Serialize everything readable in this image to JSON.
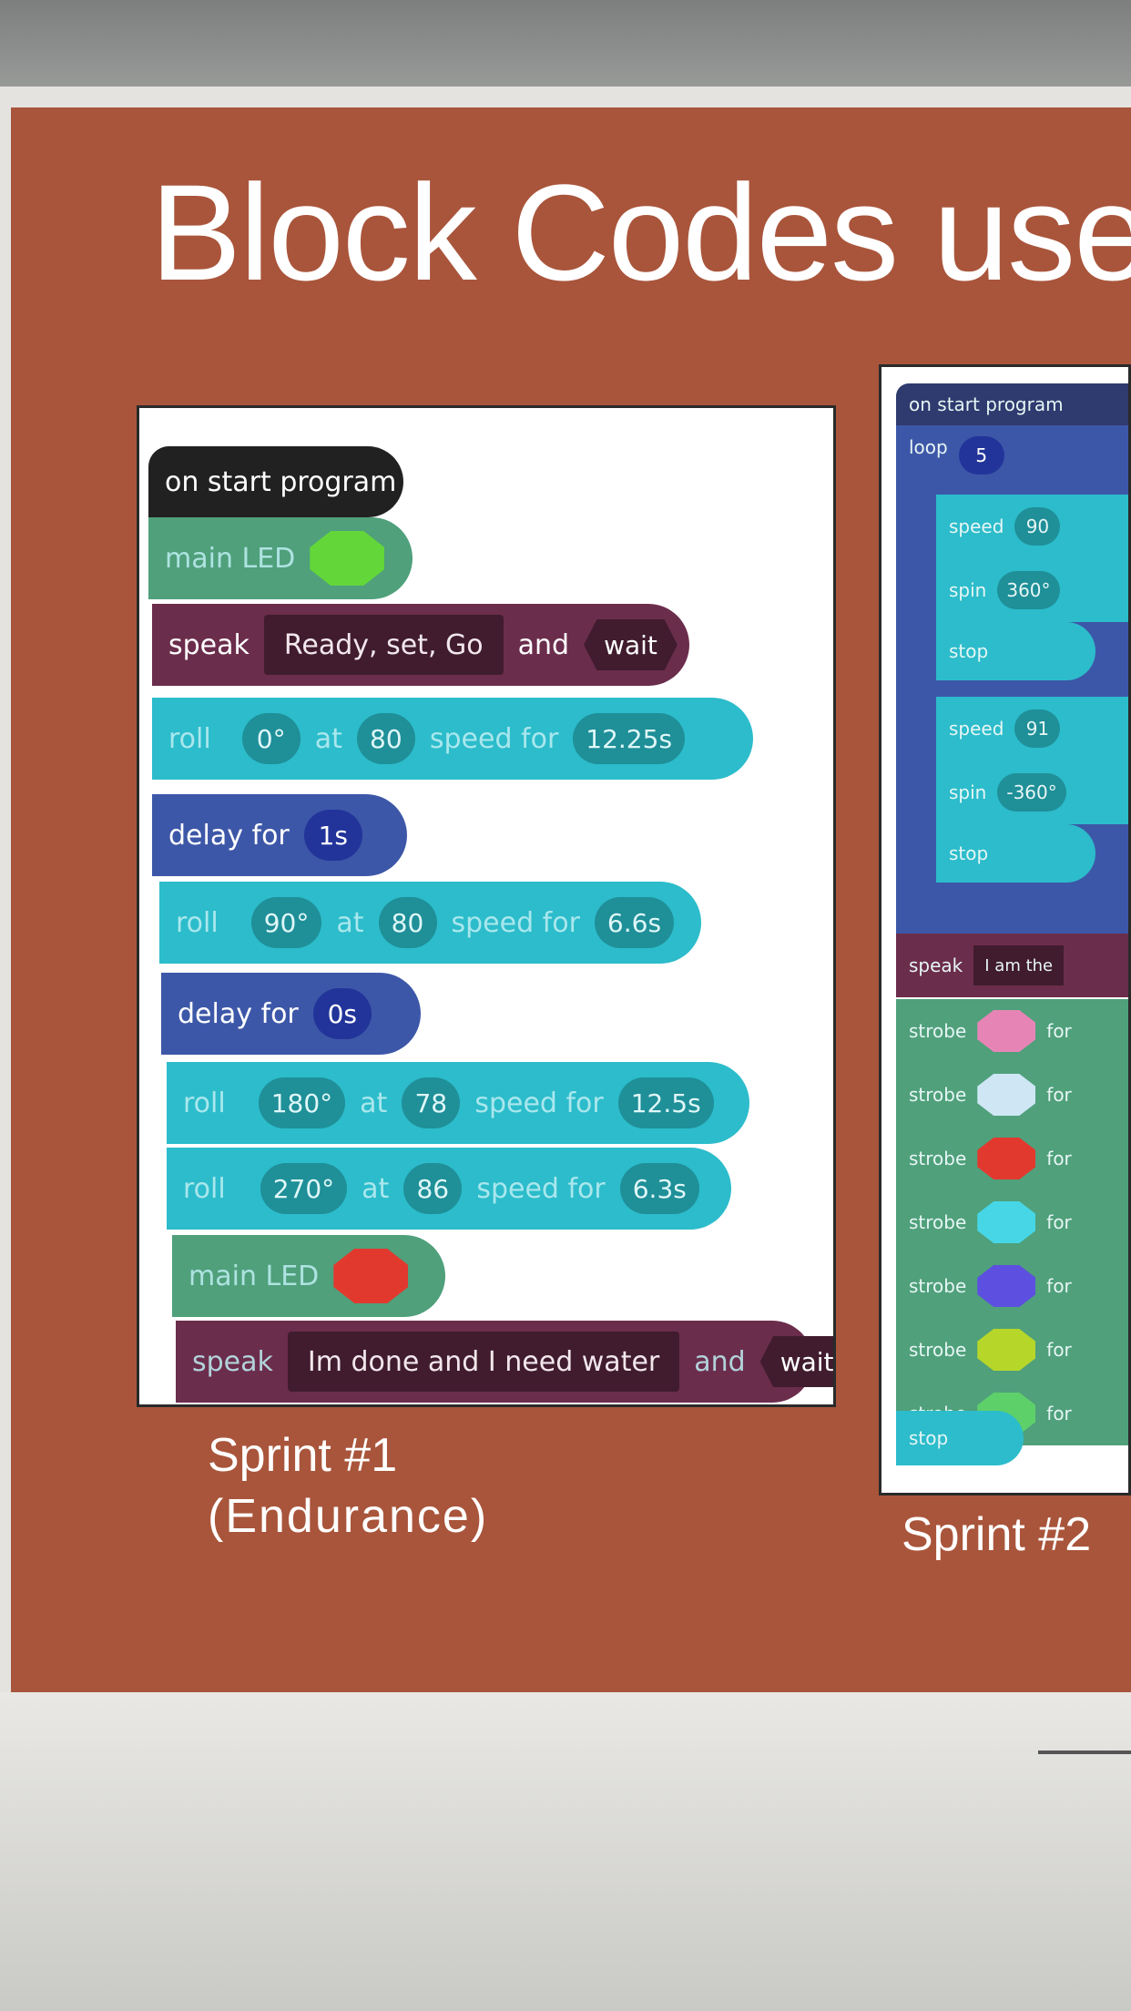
{
  "slide": {
    "title": "Block Codes use"
  },
  "sprint1": {
    "caption_line1": "Sprint #1",
    "caption_line2": "(Endurance)",
    "blocks": {
      "start": "on start program",
      "led1": {
        "label": "main LED",
        "color": "#63d63a"
      },
      "speak1": {
        "label": "speak",
        "text": "Ready, set, Go",
        "and": "and",
        "wait": "wait"
      },
      "roll1": {
        "label": "roll",
        "heading": "0°",
        "at": "at",
        "speed": "80",
        "speed_for": "speed for",
        "duration": "12.25s"
      },
      "delay1": {
        "label": "delay for",
        "value": "1s"
      },
      "roll2": {
        "label": "roll",
        "heading": "90°",
        "at": "at",
        "speed": "80",
        "speed_for": "speed for",
        "duration": "6.6s"
      },
      "delay2": {
        "label": "delay for",
        "value": "0s"
      },
      "roll3": {
        "label": "roll",
        "heading": "180°",
        "at": "at",
        "speed": "78",
        "speed_for": "speed for",
        "duration": "12.5s"
      },
      "roll4": {
        "label": "roll",
        "heading": "270°",
        "at": "at",
        "speed": "86",
        "speed_for": "speed for",
        "duration": "6.3s"
      },
      "led2": {
        "label": "main LED",
        "color": "#e2392f"
      },
      "speak2": {
        "label": "speak",
        "text": "Im done and I need water",
        "and": "and",
        "wait": "wait"
      }
    }
  },
  "sprint2": {
    "caption": "Sprint #2",
    "blocks": {
      "start": "on start program",
      "loop": {
        "label": "loop",
        "count": "5"
      },
      "speed1": {
        "label": "speed",
        "value": "90"
      },
      "spin1": {
        "label": "spin",
        "value": "360°"
      },
      "stop1": "stop",
      "speed2": {
        "label": "speed",
        "value": "91"
      },
      "spin2": {
        "label": "spin",
        "value": "-360°"
      },
      "stop2": "stop",
      "speak": {
        "label": "speak",
        "text": "I am the"
      },
      "strobes": [
        {
          "label": "strobe",
          "color": "#e685b5",
          "for": "for"
        },
        {
          "label": "strobe",
          "color": "#cfe6f4",
          "for": "for"
        },
        {
          "label": "strobe",
          "color": "#e2392f",
          "for": "for"
        },
        {
          "label": "strobe",
          "color": "#47d6e6",
          "for": "for"
        },
        {
          "label": "strobe",
          "color": "#5d4fe0",
          "for": "for"
        },
        {
          "label": "strobe",
          "color": "#b7d62a",
          "for": "for"
        },
        {
          "label": "strobe",
          "color": "#5ed06a",
          "for": "for"
        }
      ],
      "stop3": "stop"
    }
  }
}
